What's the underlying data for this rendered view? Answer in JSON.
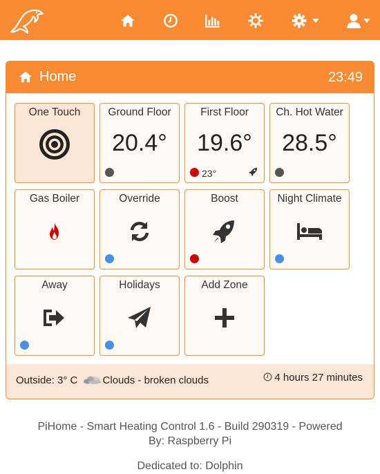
{
  "nav": {
    "logo": "dolphin-logo",
    "items": [
      {
        "name": "home-icon"
      },
      {
        "name": "clock-icon"
      },
      {
        "name": "chart-icon"
      },
      {
        "name": "settings-icon"
      },
      {
        "name": "gear-icon"
      },
      {
        "name": "user-icon"
      }
    ],
    "brand_color": "#f78a33"
  },
  "panel": {
    "title": "Home",
    "time": "23:49"
  },
  "tiles": [
    {
      "label": "One Touch"
    },
    {
      "label": "Ground Floor",
      "value": "20.4°",
      "status": "gray"
    },
    {
      "label": "First Floor",
      "value": "19.6°",
      "status": "red",
      "sub": "23°"
    },
    {
      "label": "Ch. Hot Water",
      "value": "28.5°",
      "status": "gray"
    },
    {
      "label": "Gas Boiler",
      "icon": "flame-icon"
    },
    {
      "label": "Override",
      "icon": "refresh-icon",
      "status": "blue"
    },
    {
      "label": "Boost",
      "icon": "rocket-icon",
      "status": "red"
    },
    {
      "label": "Night Climate",
      "icon": "bed-icon",
      "status": "blue"
    },
    {
      "label": "Away",
      "icon": "sign-out-icon",
      "status": "blue"
    },
    {
      "label": "Holidays",
      "icon": "paper-plane-icon",
      "status": "blue"
    },
    {
      "label": "Add Zone",
      "icon": "plus-icon"
    }
  ],
  "status_colors": {
    "gray": "#555555",
    "red": "#cc0000",
    "blue": "#4a90e2"
  },
  "weather": {
    "outside_label": "Outside: 3° C",
    "condition": "Clouds - broken clouds"
  },
  "duration": "4 hours 27 minutes",
  "footer": {
    "line1": "PiHome - Smart Heating Control 1.6   -   Build 290319   -   Powered",
    "line2": "By: Raspberry Pi",
    "dedication": "Dedicated to: Dolphin"
  }
}
